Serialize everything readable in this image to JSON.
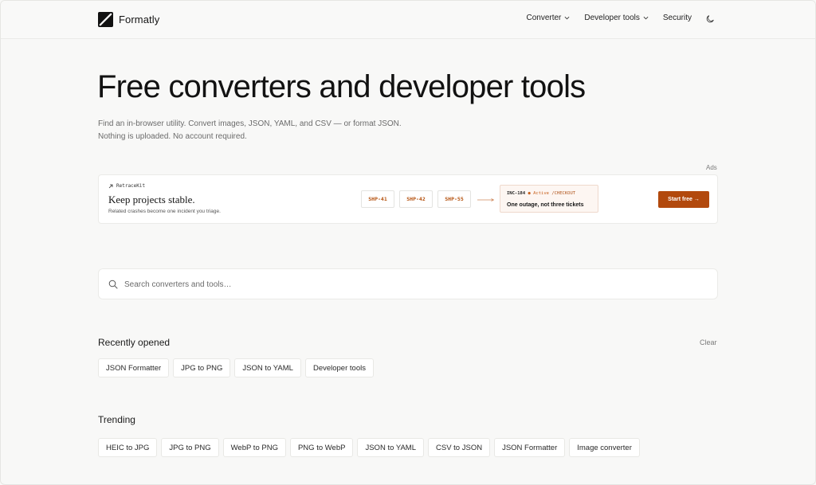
{
  "header": {
    "brand": "Formatly",
    "nav": [
      {
        "label": "Converter",
        "has_menu": true
      },
      {
        "label": "Developer tools",
        "has_menu": true
      },
      {
        "label": "Security",
        "has_menu": false
      }
    ],
    "theme_toggle_icon": "moon-icon"
  },
  "hero": {
    "title": "Free converters and developer tools",
    "subtitle_line1": "Find an in-browser utility. Convert images, JSON, YAML, and CSV — or format JSON.",
    "subtitle_line2": "Nothing is uploaded. No account required."
  },
  "ad": {
    "label": "Ads",
    "brand": "RetraceKit",
    "headline": "Keep projects stable.",
    "tagline": "Related crashes become one incident you triage.",
    "codes": [
      "SHP-41",
      "SHP-42",
      "SHP-55"
    ],
    "incident": {
      "id": "INC-184",
      "dot": "●",
      "status": "Active",
      "path": "/CHECKOUT",
      "summary": "One outage, not three tickets"
    },
    "cta": "Start free →",
    "accent": "#b2490d"
  },
  "search": {
    "placeholder": "Search converters and tools…"
  },
  "recent": {
    "title": "Recently opened",
    "clear_label": "Clear",
    "items": [
      "JSON Formatter",
      "JPG to PNG",
      "JSON to YAML",
      "Developer tools"
    ]
  },
  "trending": {
    "title": "Trending",
    "items": [
      "HEIC to JPG",
      "JPG to PNG",
      "WebP to PNG",
      "PNG to WebP",
      "JSON to YAML",
      "CSV to JSON",
      "JSON Formatter",
      "Image converter"
    ]
  }
}
